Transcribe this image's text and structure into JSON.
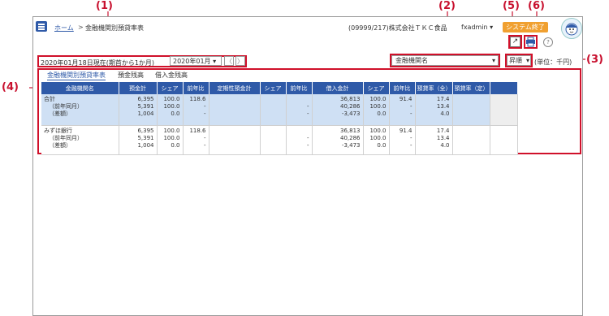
{
  "callouts": [
    "(1)",
    "(2)",
    "(3)",
    "(4)",
    "(5)",
    "(6)"
  ],
  "header": {
    "home": "ホーム",
    "separator": ">",
    "page_title": "金融機関別預貸率表",
    "company": "(09999/217)株式会社ＴＫＣ食品",
    "user": "fxadmin",
    "user_caret": "▾",
    "system_exit": "システム終了"
  },
  "filters": {
    "date_text": "2020年01月18日現在(期首から1か月)",
    "month": "2020年01月",
    "month_caret": "▾",
    "prev": "〈",
    "next": "〉",
    "bank_select": "金融機関名",
    "bank_caret": "▾",
    "sort_select": "昇順",
    "sort_caret": "▾",
    "unit": "(単位：千円)"
  },
  "icons": {
    "export": "↗",
    "print": "⎙",
    "help": "?"
  },
  "tabs": [
    "金融機関別預貸率表",
    "預金残高",
    "借入金残高"
  ],
  "table": {
    "headers": [
      "金融機関名",
      "預金計",
      "シェア",
      "前年比",
      "定期性預金計",
      "シェア",
      "前年比",
      "借入金計",
      "シェア",
      "前年比",
      "預貸率（全）",
      "預貸率（定）",
      ""
    ],
    "rows": [
      {
        "name": [
          "合計",
          "（前年同月）",
          "（差額）"
        ],
        "deposit": [
          "6,395",
          "5,391",
          "1,004"
        ],
        "share1": [
          "100.0",
          "100.0",
          "0.0"
        ],
        "yoy1": [
          "118.6",
          "-",
          "-"
        ],
        "fixed": [
          "",
          "",
          ""
        ],
        "share2": [
          "",
          "",
          ""
        ],
        "yoy2": [
          "",
          "-",
          "-"
        ],
        "loan": [
          "36,813",
          "40,286",
          "-3,473"
        ],
        "share3": [
          "100.0",
          "100.0",
          "0.0"
        ],
        "yoy3": [
          "91.4",
          "-",
          "-"
        ],
        "ratio_all": [
          "17.4",
          "13.4",
          "4.0"
        ],
        "ratio_fixed": [
          "",
          "",
          ""
        ]
      },
      {
        "name": [
          "みずほ銀行",
          "（前年同月）",
          "（差額）"
        ],
        "deposit": [
          "6,395",
          "5,391",
          "1,004"
        ],
        "share1": [
          "100.0",
          "100.0",
          "0.0"
        ],
        "yoy1": [
          "118.6",
          "-",
          "-"
        ],
        "fixed": [
          "",
          "",
          ""
        ],
        "share2": [
          "",
          "",
          ""
        ],
        "yoy2": [
          "",
          "-",
          "-"
        ],
        "loan": [
          "36,813",
          "40,286",
          "-3,473"
        ],
        "share3": [
          "100.0",
          "100.0",
          "0.0"
        ],
        "yoy3": [
          "91.4",
          "-",
          "-"
        ],
        "ratio_all": [
          "17.4",
          "13.4",
          "4.0"
        ],
        "ratio_fixed": [
          "",
          "",
          ""
        ]
      }
    ]
  },
  "colors": {
    "accent": "#2f5aa8",
    "callout": "#c8102e",
    "selected_row": "#cfe0f4",
    "system_button": "#f0a030"
  }
}
